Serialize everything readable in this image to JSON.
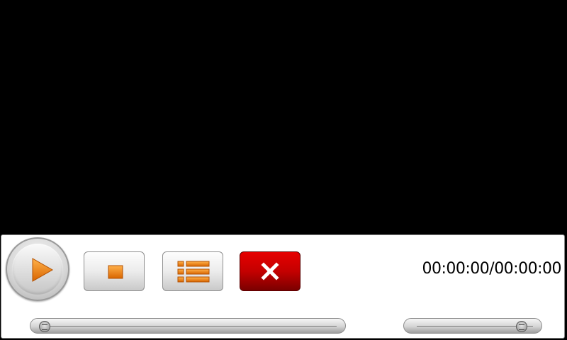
{
  "player": {
    "time_display": "00:00:00/00:00:00",
    "seek_progress": 0.0,
    "volume_level": 0.95
  },
  "buttons": {
    "play": "play-icon",
    "stop": "stop-icon",
    "playlist": "list-icon",
    "close": "close-icon"
  },
  "colors": {
    "accent_orange": "#e07000",
    "close_red": "#c40000"
  }
}
